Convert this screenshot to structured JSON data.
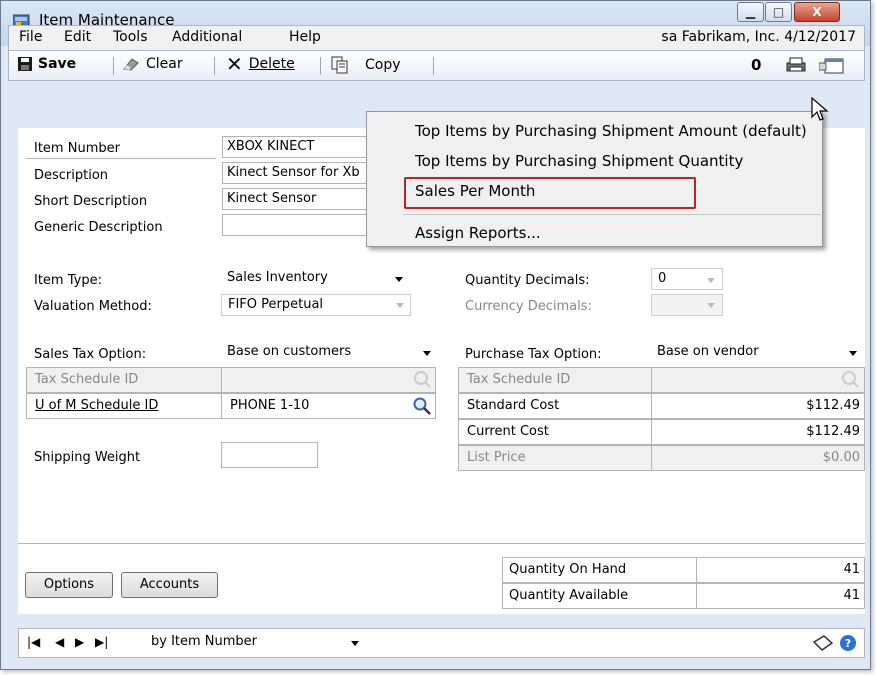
{
  "window": {
    "title": "Item Maintenance",
    "controls": {
      "minimize": "▁",
      "maximize": "□",
      "close": "X"
    }
  },
  "menu": {
    "items": [
      "File",
      "Edit",
      "Tools",
      "Additional",
      "Help"
    ],
    "user_info": "sa  Fabrikam, Inc.  4/12/2017"
  },
  "toolbar": {
    "save": "Save",
    "clear": "Clear",
    "delete": "Delete",
    "copy": "Copy"
  },
  "fields": {
    "item_number_label": "Item Number",
    "item_number": "XBOX KINECT",
    "description_label": "Description",
    "description": "Kinect Sensor for Xb",
    "short_description_label": "Short Description",
    "short_description": "Kinect Sensor",
    "generic_description_label": "Generic Description",
    "generic_description": "",
    "item_type_label": "Item Type:",
    "item_type": "Sales Inventory",
    "valuation_method_label": "Valuation Method:",
    "valuation_method": "FIFO Perpetual",
    "quantity_decimals_label": "Quantity Decimals:",
    "quantity_decimals": "0",
    "currency_decimals_label": "Currency Decimals:",
    "currency_decimals": "",
    "sales_tax_option_label": "Sales Tax Option:",
    "sales_tax_option": "Base on customers",
    "tax_schedule_id_label": "Tax Schedule ID",
    "uofm_schedule_id_label": "U of M Schedule ID",
    "uofm_schedule_id": "PHONE 1-10",
    "shipping_weight_label": "Shipping Weight",
    "shipping_weight": "",
    "purchase_tax_option_label": "Purchase Tax Option:",
    "purchase_tax_option": "Base on vendor",
    "purchase_tax_schedule_id_label": "Tax Schedule ID",
    "standard_cost_label": "Standard Cost",
    "standard_cost": "$112.49",
    "current_cost_label": "Current Cost",
    "current_cost": "$112.49",
    "list_price_label": "List Price",
    "list_price": "$0.00",
    "quantity_on_hand_label": "Quantity On Hand",
    "quantity_on_hand": "41",
    "quantity_available_label": "Quantity Available",
    "quantity_available": "41"
  },
  "buttons": {
    "options": "Options",
    "accounts": "Accounts"
  },
  "navigation": {
    "sort_by": "by Item Number"
  },
  "reports_menu": {
    "items": [
      "Top Items by Purchasing Shipment Amount (default)",
      "Top Items by Purchasing Shipment Quantity",
      "Sales Per Month",
      "Assign Reports..."
    ],
    "highlighted": "Sales Per Month"
  }
}
